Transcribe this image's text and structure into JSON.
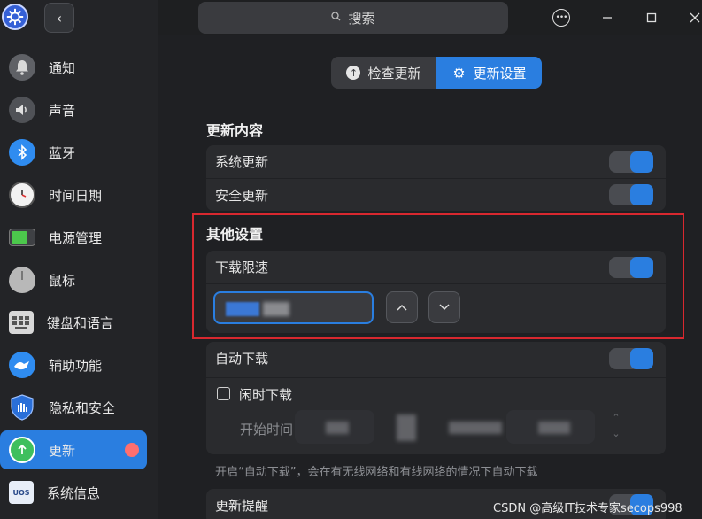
{
  "window": {
    "search_placeholder": "搜索"
  },
  "sidebar": {
    "items": [
      {
        "label": "通知",
        "icon": "bell-icon"
      },
      {
        "label": "声音",
        "icon": "speaker-icon"
      },
      {
        "label": "蓝牙",
        "icon": "bluetooth-icon"
      },
      {
        "label": "时间日期",
        "icon": "clock-icon"
      },
      {
        "label": "电源管理",
        "icon": "battery-icon"
      },
      {
        "label": "鼠标",
        "icon": "mouse-icon"
      },
      {
        "label": "键盘和语言",
        "icon": "keyboard-icon"
      },
      {
        "label": "辅助功能",
        "icon": "accessibility-icon"
      },
      {
        "label": "隐私和安全",
        "icon": "shield-icon"
      },
      {
        "label": "更新",
        "icon": "update-icon",
        "active": true,
        "badge": true
      },
      {
        "label": "系统信息",
        "icon": "system-info-icon"
      }
    ]
  },
  "tabs": [
    {
      "label": "检查更新",
      "icon": "arrow-up-circle-icon"
    },
    {
      "label": "更新设置",
      "icon": "gear-icon",
      "selected": true
    }
  ],
  "sections": {
    "update_content": {
      "title": "更新内容",
      "items": [
        {
          "label": "系统更新",
          "enabled": true
        },
        {
          "label": "安全更新",
          "enabled": true
        }
      ]
    },
    "other": {
      "title": "其他设置",
      "speed_limit": {
        "label": "下载限速",
        "enabled": true
      }
    },
    "auto_download": {
      "label": "自动下载",
      "enabled": true,
      "idle_download": {
        "label": "闲时下载",
        "checked": false
      },
      "start_time_label": "开始时间"
    },
    "hint": "开启“自动下载”，会在有无线网络和有线网络的情况下自动下载",
    "update_reminder": {
      "label": "更新提醒",
      "enabled": true
    }
  },
  "watermark": "CSDN @高级IT技术专家secops998",
  "colors": {
    "accent": "#2a7ee0",
    "highlight_border": "#d8282f",
    "badge": "#ff6f6f"
  }
}
